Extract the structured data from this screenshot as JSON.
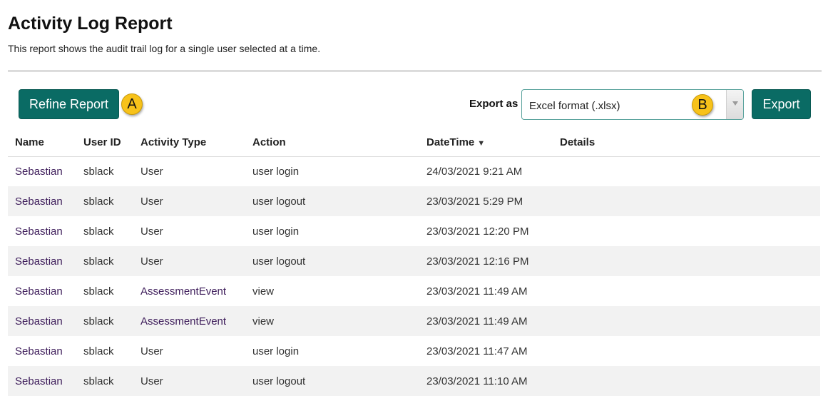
{
  "page": {
    "title": "Activity Log Report",
    "subtitle": "This report shows the audit trail log for a single user selected at a time."
  },
  "toolbar": {
    "refine_label": "Refine Report",
    "badge_a": "A",
    "export_as_label": "Export as",
    "export_format": "Excel format (.xlsx)",
    "badge_b": "B",
    "export_label": "Export"
  },
  "table": {
    "headers": [
      "Name",
      "User ID",
      "Activity Type",
      "Action",
      "DateTime",
      "Details"
    ],
    "sorted_column": "DateTime",
    "sort_icon": "▼",
    "rows": [
      {
        "name": "Sebastian",
        "user_id": "sblack",
        "activity_type": "User",
        "action": "user login",
        "datetime": "24/03/2021 9:21 AM",
        "details": ""
      },
      {
        "name": "Sebastian",
        "user_id": "sblack",
        "activity_type": "User",
        "action": "user logout",
        "datetime": "23/03/2021 5:29 PM",
        "details": ""
      },
      {
        "name": "Sebastian",
        "user_id": "sblack",
        "activity_type": "User",
        "action": "user login",
        "datetime": "23/03/2021 12:20 PM",
        "details": ""
      },
      {
        "name": "Sebastian",
        "user_id": "sblack",
        "activity_type": "User",
        "action": "user logout",
        "datetime": "23/03/2021 12:16 PM",
        "details": ""
      },
      {
        "name": "Sebastian",
        "user_id": "sblack",
        "activity_type": "AssessmentEvent",
        "action": "view",
        "datetime": "23/03/2021 11:49 AM",
        "details": ""
      },
      {
        "name": "Sebastian",
        "user_id": "sblack",
        "activity_type": "AssessmentEvent",
        "action": "view",
        "datetime": "23/03/2021 11:49 AM",
        "details": ""
      },
      {
        "name": "Sebastian",
        "user_id": "sblack",
        "activity_type": "User",
        "action": "user login",
        "datetime": "23/03/2021 11:47 AM",
        "details": ""
      },
      {
        "name": "Sebastian",
        "user_id": "sblack",
        "activity_type": "User",
        "action": "user logout",
        "datetime": "23/03/2021 11:10 AM",
        "details": ""
      }
    ]
  },
  "colors": {
    "button": "#0a6b64",
    "badge": "#f7c21a",
    "link": "#3d1c5a",
    "row_alt": "#f2f2f2"
  }
}
